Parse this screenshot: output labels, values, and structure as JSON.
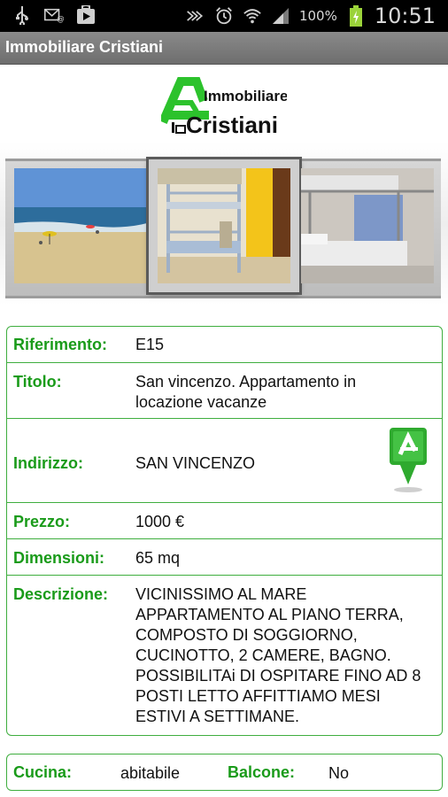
{
  "status_bar": {
    "icons_left": [
      "usb-icon",
      "missed-email-icon",
      "play-store-icon"
    ],
    "icons_right": [
      "nfc-icon",
      "alarm-icon",
      "wifi-icon",
      "signal-icon"
    ],
    "battery": "100%",
    "time": "10:51"
  },
  "app": {
    "title": "Immobiliare Cristiani"
  },
  "logo": {
    "line1": "Immobiliare",
    "line2": "Cristiani"
  },
  "details": {
    "riferimento": {
      "label": "Riferimento:",
      "value": "E15"
    },
    "titolo": {
      "label": "Titolo:",
      "value_line1": "San vincenzo. Appartamento in",
      "value_line2": "locazione vacanze"
    },
    "indirizzo": {
      "label": "Indirizzo:",
      "value": "SAN VINCENZO"
    },
    "prezzo": {
      "label": "Prezzo:",
      "value": "1000 €"
    },
    "dimensioni": {
      "label": "Dimensioni:",
      "value": "65 mq"
    },
    "descrizione": {
      "label": "Descrizione:",
      "lines": [
        "VICINISSIMO AL MARE",
        "APPARTAMENTO AL PIANO TERRA,",
        "COMPOSTO DI SOGGIORNO,",
        "CUCINOTTO, 2 CAMERE, BAGNO.",
        "POSSIBILITAi DI OSPITARE FINO AD 8",
        "POSTI LETTO AFFITTIAMO MESI",
        "ESTIVI A SETTIMANE."
      ]
    }
  },
  "features": {
    "cucina": {
      "label": "Cucina:",
      "value": "abitabile"
    },
    "balcone": {
      "label": "Balcone:",
      "value": "No"
    }
  },
  "colors": {
    "accent_green": "#1a9b1a",
    "border_green": "#3fae3f"
  }
}
